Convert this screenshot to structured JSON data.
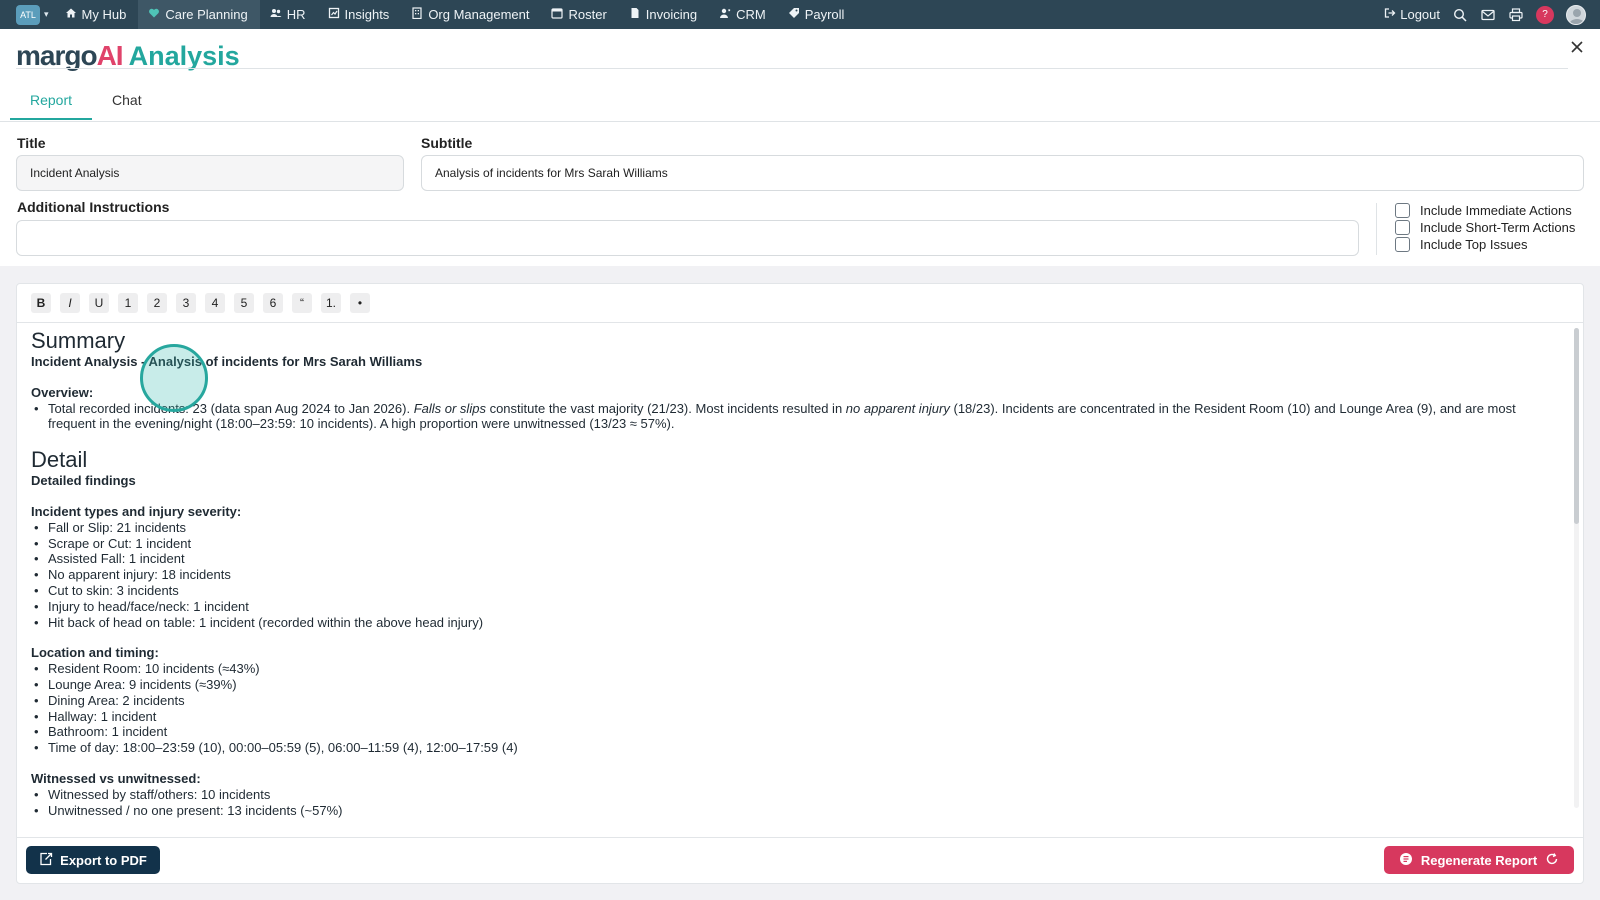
{
  "nav": {
    "org_badge": "ATL",
    "items": [
      {
        "label": "My Hub",
        "icon": "home-icon"
      },
      {
        "label": "Care Planning",
        "icon": "heart-icon"
      },
      {
        "label": "HR",
        "icon": "people-icon"
      },
      {
        "label": "Insights",
        "icon": "insights-icon"
      },
      {
        "label": "Org Management",
        "icon": "building-icon"
      },
      {
        "label": "Roster",
        "icon": "roster-icon"
      },
      {
        "label": "Invoicing",
        "icon": "document-icon"
      },
      {
        "label": "CRM",
        "icon": "contacts-icon"
      },
      {
        "label": "Payroll",
        "icon": "tag-icon"
      }
    ],
    "active": "Care Planning",
    "logout": "Logout",
    "help": "?"
  },
  "header": {
    "brand_prefix": "margo",
    "brand_ai": "AI",
    "title": "Analysis",
    "tabs": [
      "Report",
      "Chat"
    ],
    "active_tab": "Report"
  },
  "form": {
    "title_label": "Title",
    "title_value": "Incident Analysis",
    "subtitle_label": "Subtitle",
    "subtitle_value": "Analysis of incidents for Mrs Sarah Williams",
    "instructions_label": "Additional Instructions",
    "instructions_value": "",
    "options": [
      {
        "label": "Include Immediate Actions",
        "checked": false
      },
      {
        "label": "Include Short-Term Actions",
        "checked": false
      },
      {
        "label": "Include Top Issues",
        "checked": false
      }
    ]
  },
  "toolbar": [
    "B",
    "I",
    "U",
    "1",
    "2",
    "3",
    "4",
    "5",
    "6",
    "“",
    "1.",
    "•"
  ],
  "report": {
    "summary_heading": "Summary",
    "summary_sub": "Incident Analysis - Analysis of incidents for Mrs Sarah Williams",
    "overview_label": "Overview:",
    "overview": {
      "p1": "Total recorded incidents: 23 (data span Aug 2024 to Jan 2026). ",
      "em1": "Falls or slips",
      "p2": " constitute the vast majority (21/23). Most incidents resulted in ",
      "em2": "no apparent injury",
      "p3": " (18/23). Incidents are concentrated in the Resident Room (10) and Lounge Area (9), and are most frequent in the evening/night (18:00–23:59: 10 incidents). A high proportion were unwitnessed (13/23 ≈ 57%)."
    },
    "detail_heading": "Detail",
    "detail_sub": "Detailed findings",
    "types_label": "Incident types and injury severity:",
    "types": [
      "Fall or Slip: 21 incidents",
      "Scrape or Cut: 1 incident",
      "Assisted Fall: 1 incident",
      "No apparent injury: 18 incidents",
      "Cut to skin: 3 incidents",
      "Injury to head/face/neck: 1 incident",
      "Hit back of head on table: 1 incident (recorded within the above head injury)"
    ],
    "location_label": "Location and timing:",
    "location": [
      "Resident Room: 10 incidents (≈43%)",
      "Lounge Area: 9 incidents (≈39%)",
      "Dining Area: 2 incidents",
      "Hallway: 1 incident",
      "Bathroom: 1 incident",
      "Time of day: 18:00–23:59 (10), 00:00–05:59 (5), 06:00–11:59 (4), 12:00–17:59 (4)"
    ],
    "witness_label": "Witnessed vs unwitnessed:",
    "witness": [
      "Witnessed by staff/others: 10 incidents",
      "Unwitnessed / no one present: 13 incidents (~57%)"
    ]
  },
  "actions": {
    "export": "Export to PDF",
    "regenerate": "Regenerate Report"
  },
  "colors": {
    "nav_bg": "#2d4655",
    "accent": "#23a79e",
    "brand_pink": "#e0436b",
    "export_bg": "#12324a",
    "regenerate_bg": "#d7385e"
  }
}
